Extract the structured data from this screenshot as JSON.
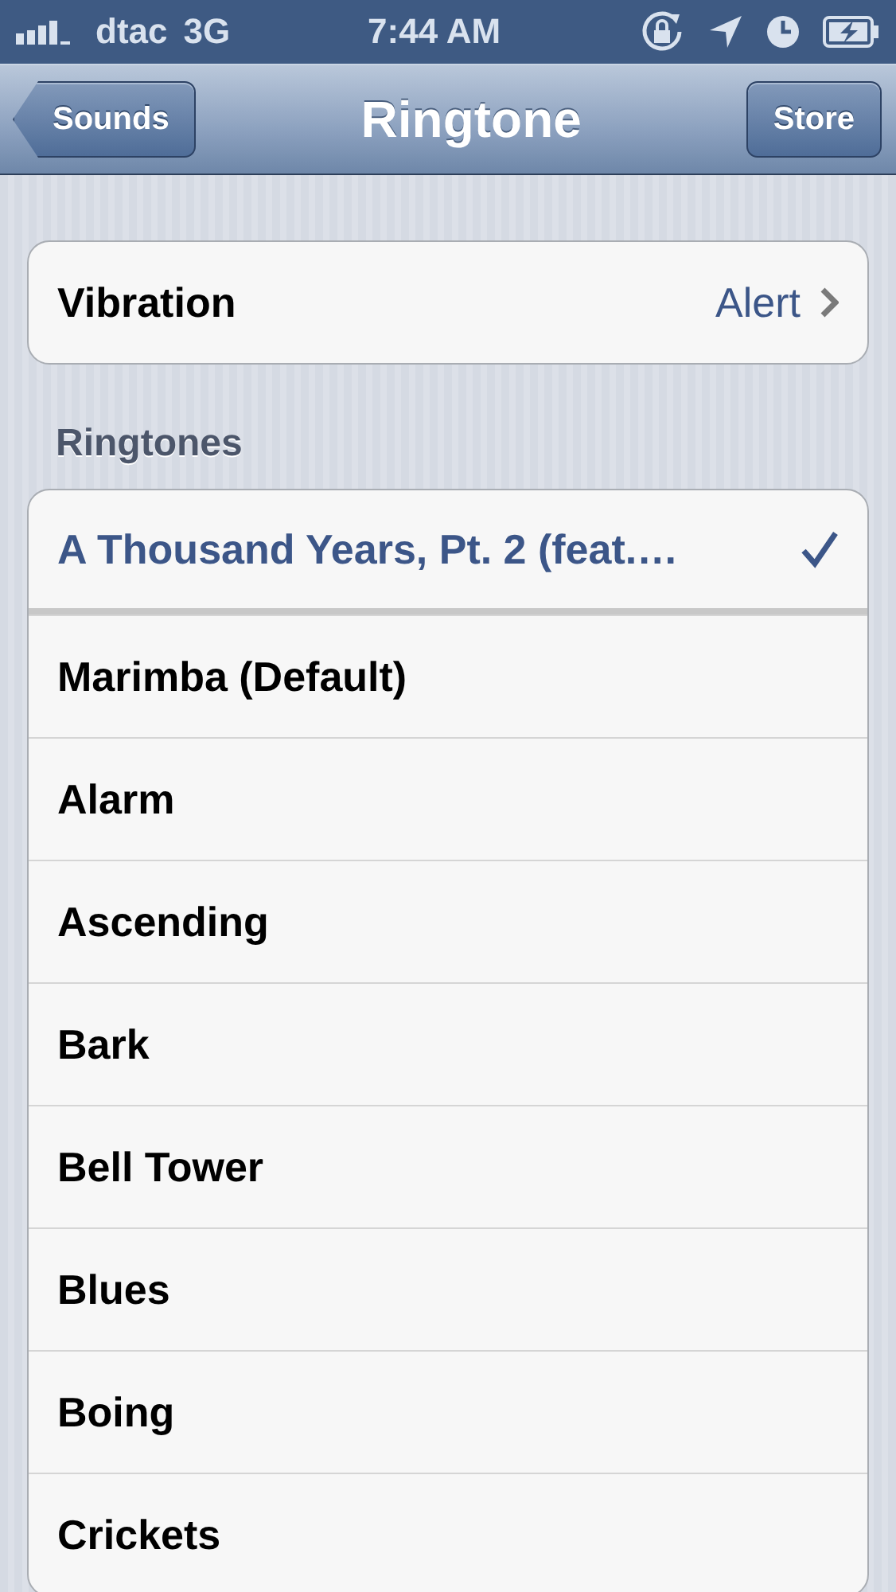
{
  "status_bar": {
    "carrier": "dtac",
    "network": "3G",
    "time": "7:44 AM"
  },
  "nav_bar": {
    "back_button": "Sounds",
    "title": "Ringtone",
    "right_button": "Store"
  },
  "vibration": {
    "label": "Vibration",
    "value": "Alert"
  },
  "ringtones": {
    "header": "Ringtones",
    "items": [
      {
        "name": "A Thousand Years, Pt. 2 (feat.…",
        "selected": true
      },
      {
        "name": "Marimba (Default)",
        "selected": false
      },
      {
        "name": "Alarm",
        "selected": false
      },
      {
        "name": "Ascending",
        "selected": false
      },
      {
        "name": "Bark",
        "selected": false
      },
      {
        "name": "Bell Tower",
        "selected": false
      },
      {
        "name": "Blues",
        "selected": false
      },
      {
        "name": "Boing",
        "selected": false
      },
      {
        "name": "Crickets",
        "selected": false
      }
    ]
  }
}
